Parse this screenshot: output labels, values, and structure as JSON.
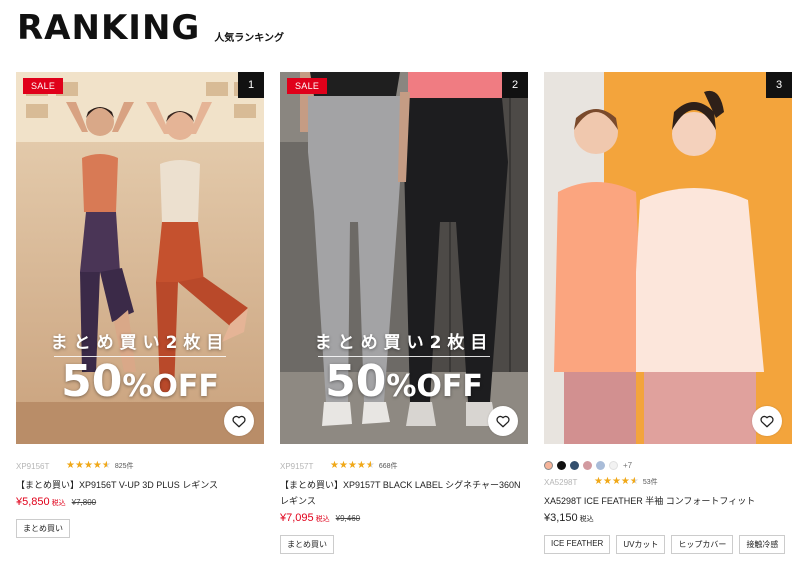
{
  "header": {
    "title": "RANKING",
    "subtitle": "人気ランキング"
  },
  "products": [
    {
      "rank": "1",
      "sale_badge": "SALE",
      "promo": {
        "line1": "まとめ買い2枚目",
        "percent": "50",
        "pct_sign": "%",
        "off": "OFF"
      },
      "code": "XP9156T",
      "rating": 4.5,
      "review_count": "825件",
      "name": "【まとめ買い】XP9156T V-UP 3D PLUS レギンス",
      "price": "¥5,850",
      "tax_label": "税込",
      "old_price": "¥7,800",
      "tags": [
        "まとめ買い"
      ]
    },
    {
      "rank": "2",
      "sale_badge": "SALE",
      "promo": {
        "line1": "まとめ買い2枚目",
        "percent": "50",
        "pct_sign": "%",
        "off": "OFF"
      },
      "code": "XP9157T",
      "rating": 4.5,
      "review_count": "668件",
      "name": "【まとめ買い】XP9157T BLACK LABEL シグネチャー360N レギンス",
      "price": "¥7,095",
      "tax_label": "税込",
      "old_price": "¥9,460",
      "tags": [
        "まとめ買い"
      ]
    },
    {
      "rank": "3",
      "code": "XA5298T",
      "rating": 4.5,
      "review_count": "53件",
      "swatches": [
        "#f6b49a",
        "#111111",
        "#34506e",
        "#d29aa0",
        "#a9bcd8",
        "#f2f2f2"
      ],
      "more_colors": "+7",
      "name": "XA5298T ICE FEATHER 半袖 コンフォートフィット",
      "price": "¥3,150",
      "tax_label": "税込",
      "tags": [
        "ICE FEATHER",
        "UVカット",
        "ヒップカバー",
        "接触冷感"
      ]
    }
  ],
  "colors": {
    "sale": "#e0001a",
    "star": "#f0a818",
    "rank_bg": "#111111"
  },
  "icons": {
    "wishlist": "heart-outline-icon",
    "rating": "star-icon"
  }
}
